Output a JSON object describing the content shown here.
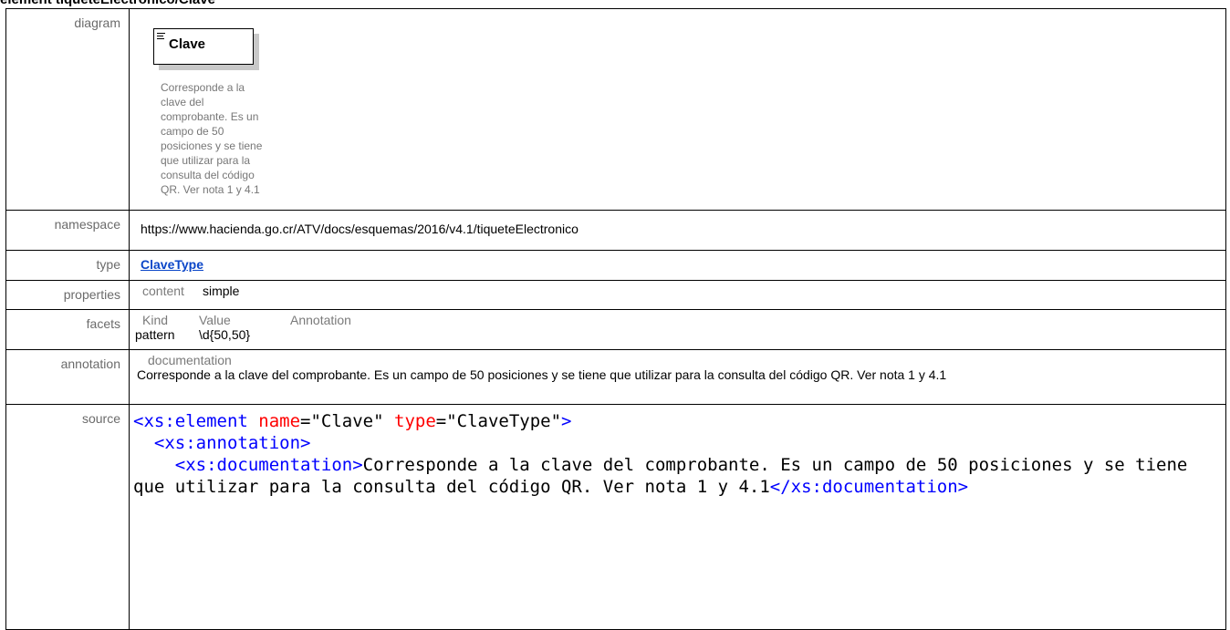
{
  "heading": "element tiqueteElectronico/Clave",
  "rows": {
    "diagram": {
      "label": "diagram",
      "element_name": "Clave",
      "element_doc": "Corresponde a la clave del comprobante. Es un campo de 50 posiciones y se tiene que utilizar para la consulta del código QR. Ver nota 1 y 4.1",
      "icon": "element-lines-icon"
    },
    "namespace": {
      "label": "namespace",
      "value": "https://www.hacienda.go.cr/ATV/docs/esquemas/2016/v4.1/tiqueteElectronico"
    },
    "type": {
      "label": "type",
      "value": "ClaveType"
    },
    "properties": {
      "label": "properties",
      "key": "content",
      "value": "simple"
    },
    "facets": {
      "label": "facets",
      "headers": [
        "Kind",
        "Value",
        "Annotation"
      ],
      "kind": "pattern",
      "value": "\\d{50,50}"
    },
    "annotation": {
      "label": "annotation",
      "sub_label": "documentation",
      "text": "Corresponde a la clave del comprobante. Es un campo de 50 posiciones y se tiene que utilizar para la consulta del código QR. Ver nota 1 y 4.1"
    },
    "source": {
      "label": "source",
      "line1_open": "<xs:element ",
      "line1_attr1": "name",
      "line1_eq1": "=\"Clave\" ",
      "line1_attr2": "type",
      "line1_eq2": "=\"ClaveType\"",
      "line1_close": ">",
      "line2": "  <xs:annotation>",
      "line3_open": "    <xs:documentation>",
      "doc_text": "Corresponde a la clave del comprobante. Es un campo de 50 posiciones y se tiene que utilizar para la consulta del código QR. Ver nota 1 y 4.1",
      "line3_close": "</xs:documentation>"
    }
  },
  "colors": {
    "label_gray": "#6b6b6b",
    "link_blue": "#0b46c8",
    "xml_tag": "#0000ff",
    "xml_attr": "#ff0000"
  }
}
